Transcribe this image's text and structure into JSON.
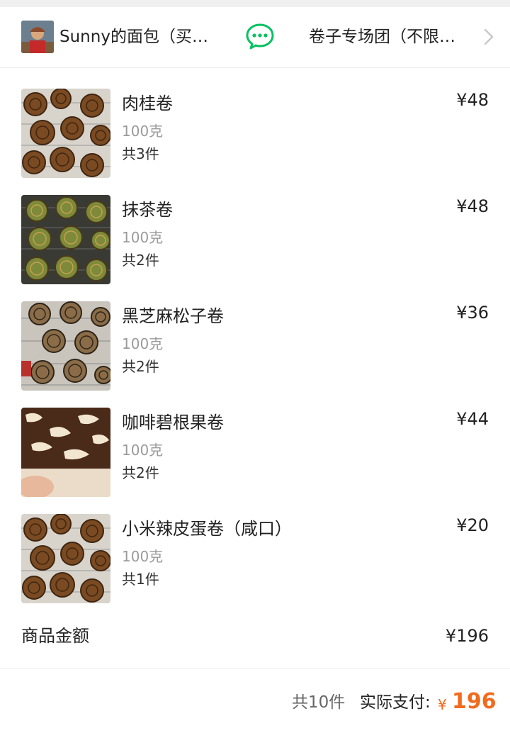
{
  "header": {
    "shop_name": "Sunny的面包（买…",
    "group_name": "卷子专场团（不限…",
    "icons": {
      "share": "wechat-icon",
      "more": "chevron-right-icon"
    }
  },
  "items": [
    {
      "name": "肉桂卷",
      "spec": "100克",
      "qty": "共3件",
      "price": "¥48",
      "image": "cinnamon-roll-photo"
    },
    {
      "name": "抹茶卷",
      "spec": "100克",
      "qty": "共2件",
      "price": "¥48",
      "image": "matcha-roll-photo"
    },
    {
      "name": "黑芝麻松子卷",
      "spec": "100克",
      "qty": "共2件",
      "price": "¥36",
      "image": "black-sesame-roll-photo"
    },
    {
      "name": "咖啡碧根果卷",
      "spec": "100克",
      "qty": "共2件",
      "price": "¥44",
      "image": "coffee-pecan-roll-photo"
    },
    {
      "name": "小米辣皮蛋卷（咸口）",
      "spec": "100克",
      "qty": "共1件",
      "price": "¥20",
      "image": "chili-egg-roll-photo"
    }
  ],
  "summary": {
    "subtotal_label": "商品金额",
    "subtotal_value": "¥196"
  },
  "footer": {
    "total_count": "共10件",
    "pay_label": "实际支付:",
    "currency": "¥",
    "pay_amount": "196"
  },
  "colors": {
    "accent": "#f26b1d",
    "wechat_green": "#07c160",
    "muted_text": "#9a9a9a",
    "divider": "#ececec"
  }
}
